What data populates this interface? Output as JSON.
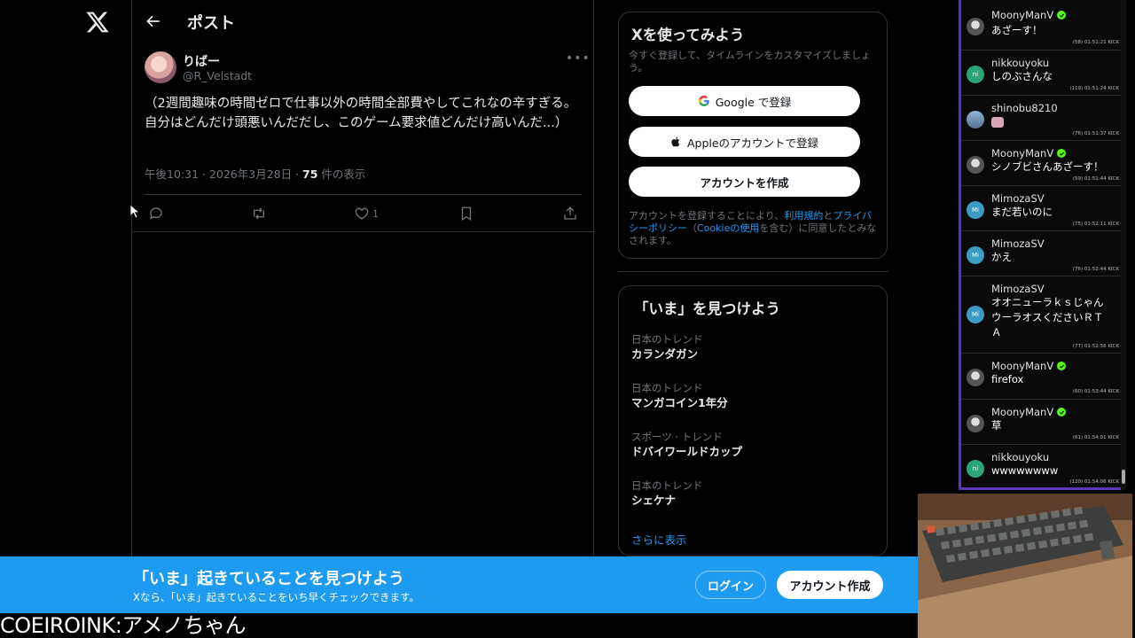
{
  "topbar": {
    "title": "ポスト"
  },
  "post": {
    "author_name": "りばー",
    "author_handle": "@R_Velstadt",
    "text": "（2週間趣味の時間ゼロで仕事以外の時間全部費やしてこれなの辛すぎる。自分はどんだけ頭悪いんだだし、このゲーム要求値どんだけ高いんだ...）",
    "meta_time": "午後10:31 · 2026年3月28日 · ",
    "views_count": "75",
    "views_label": " 件の表示",
    "like_count": "1"
  },
  "signup_card": {
    "title": "Xを使ってみよう",
    "subtitle": "今すぐ登録して、タイムラインをカスタマイズしましょう。",
    "google_label": "Google で登録",
    "apple_label": "Appleのアカウントで登録",
    "create_label": "アカウントを作成",
    "legal_prefix": "アカウントを登録することにより、",
    "terms_link": "利用規約",
    "legal_and": "と",
    "privacy_link": "プライバシーポリシー",
    "legal_paren_open": "（",
    "cookie_link": "Cookieの使用",
    "legal_suffix": "を含む）に同意したとみなされます。"
  },
  "trends_card": {
    "title": "「いま」を見つけよう",
    "trends": [
      {
        "category": "日本のトレンド",
        "name": "カランダガン"
      },
      {
        "category": "日本のトレンド",
        "name": "マンガコイン1年分"
      },
      {
        "category": "スポーツ · トレンド",
        "name": "ドバイワールドカップ"
      },
      {
        "category": "日本のトレンド",
        "name": "シェケナ"
      }
    ],
    "show_more": "さらに表示"
  },
  "banner": {
    "title": "「いま」起きていることを見つけよう",
    "subtitle": "Xなら、「いま」起きていることをいち早くチェックできます。",
    "login_label": "ログイン",
    "signup_label": "アカウント作成"
  },
  "overlay_caption": "COEIROINK:アメノちゃん",
  "chat": {
    "messages": [
      {
        "user": "MoonyManV",
        "verified": true,
        "text": "あざーす！",
        "meta": "(58)  01:51:21  KICK",
        "avatar": ""
      },
      {
        "user": "nikkouyoku",
        "verified": false,
        "text": "しのぶさんな",
        "meta": "(119)  01:51:24  KICK",
        "avatar": "ni"
      },
      {
        "user": "shinobu8210",
        "verified": false,
        "text": "",
        "meta": "(76)  01:51:37  KICK",
        "avatar": ""
      },
      {
        "user": "MoonyManV",
        "verified": true,
        "text": "シノブビさんあざーす！",
        "meta": "(59)  01:51:44  KICK",
        "avatar": ""
      },
      {
        "user": "MimozaSV",
        "verified": false,
        "text": "まだ若いのに",
        "meta": "(75)  01:52:11  KICK",
        "avatar": "Mi"
      },
      {
        "user": "MimozaSV",
        "verified": false,
        "text": "かえ",
        "meta": "(76)  01:52:44  KICK",
        "avatar": "Mi"
      },
      {
        "user": "MimozaSV",
        "verified": false,
        "text": "オオニューラｋｓじゃんウーラオスくださいＲＴＡ",
        "meta": "(77)  01:52:56  KICK",
        "avatar": "Mi"
      },
      {
        "user": "MoonyManV",
        "verified": true,
        "text": "firefox",
        "meta": "(60)  01:53:44  KICK",
        "avatar": ""
      },
      {
        "user": "MoonyManV",
        "verified": true,
        "text": "草",
        "meta": "(61)  01:54:01  KICK",
        "avatar": ""
      },
      {
        "user": "nikkouyoku",
        "verified": false,
        "text": "wwwwwwww",
        "meta": "(120)  01:54:06  KICK",
        "avatar": "ni"
      }
    ]
  },
  "colors": {
    "x_blue": "#1d9bf0",
    "kick_green": "#53fc18",
    "chat_border": "#5a37b8"
  }
}
